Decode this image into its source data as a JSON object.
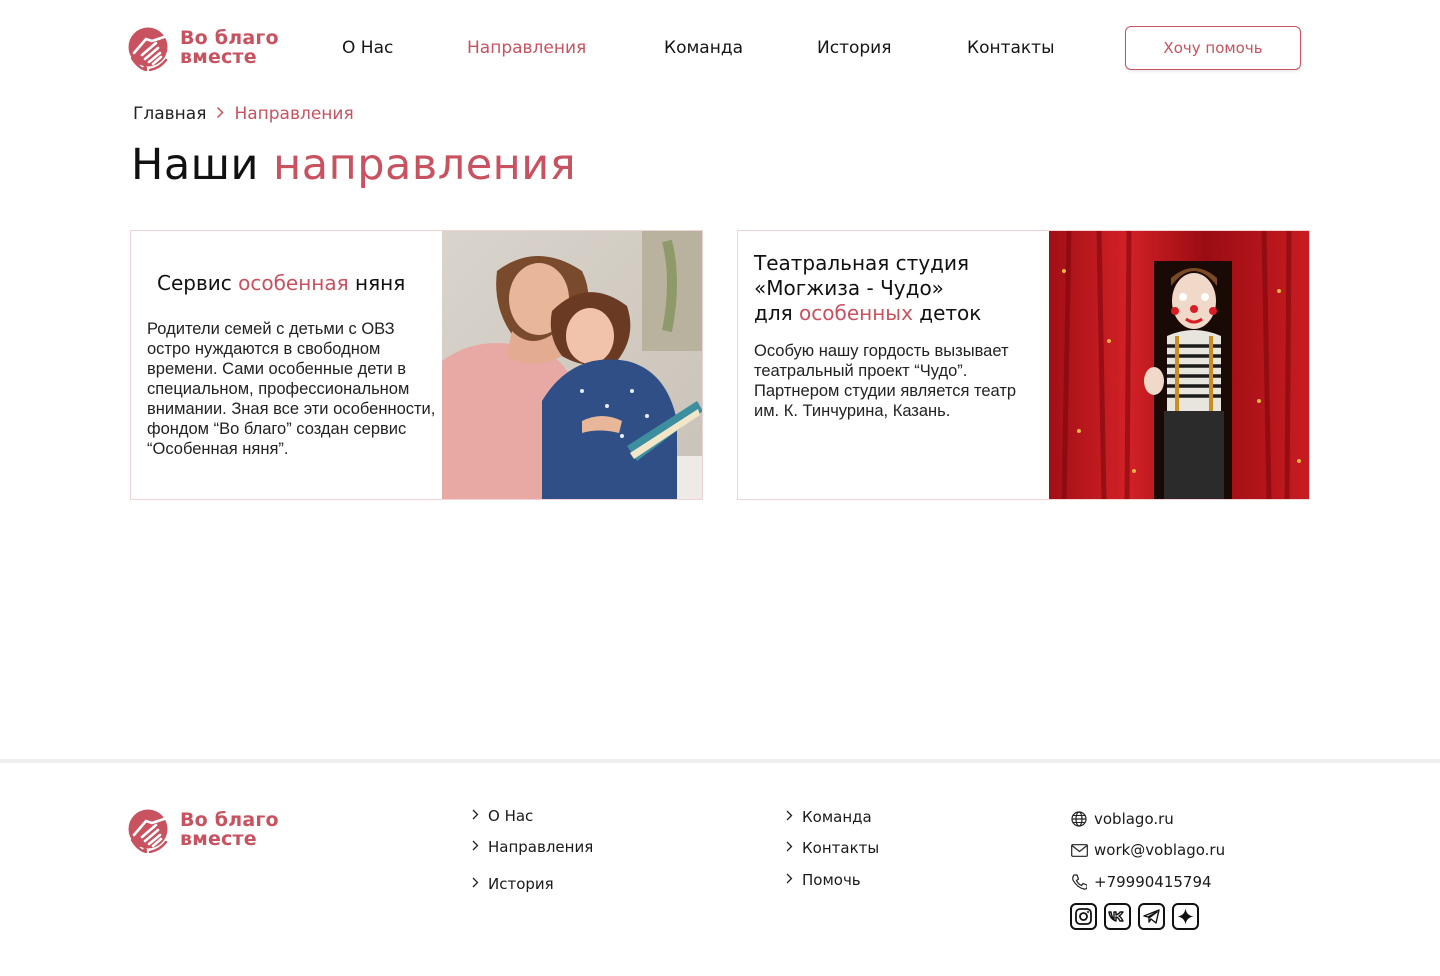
{
  "brand": {
    "line1": "Во благо",
    "line2": "вместе",
    "accent_color": "#c8525f"
  },
  "nav": {
    "items": [
      {
        "label": "О Нас",
        "active": false
      },
      {
        "label": "Направления",
        "active": true
      },
      {
        "label": "Команда",
        "active": false
      },
      {
        "label": "История",
        "active": false
      },
      {
        "label": "Контакты",
        "active": false
      }
    ],
    "cta": "Хочу помочь"
  },
  "breadcrumb": {
    "home": "Главная",
    "current": "Направления"
  },
  "page_title": {
    "plain": "Наши",
    "accent": "направления"
  },
  "cards": [
    {
      "title_before": "Сервис",
      "title_accent": "особенная",
      "title_after": "няня",
      "body": "Родители семей с детьми с ОВЗ остро нуждаются в свободном времени. Сами особенные дети в специальном, профессиональном внимании. Зная все эти особенности, фондом “Во благо” создан сервис “Особенная няня”.",
      "image": "mother-reading-book-to-daughter-photo"
    },
    {
      "title_line1": "Театральная студия",
      "title_line2": "«Могжиза - Чудо»",
      "title_line3_before": "для",
      "title_line3_accent": "особенных",
      "title_line3_after": "деток",
      "body": "Особую нашу гордость вызывает театральный проект “Чудо”. Партнером студии является театр им. К. Тинчурина, Казань.",
      "image": "child-clown-behind-red-curtain-photo"
    }
  ],
  "footer": {
    "links_col1": [
      "О Нас",
      "Направления",
      "История"
    ],
    "links_col2": [
      "Команда",
      "Контакты",
      "Помочь"
    ],
    "contacts": {
      "site": "voblago.ru",
      "email": "work@voblago.ru",
      "phone": "+79990415794"
    },
    "socials": [
      "instagram-icon",
      "vk-icon",
      "telegram-icon",
      "sparkle-icon"
    ]
  }
}
